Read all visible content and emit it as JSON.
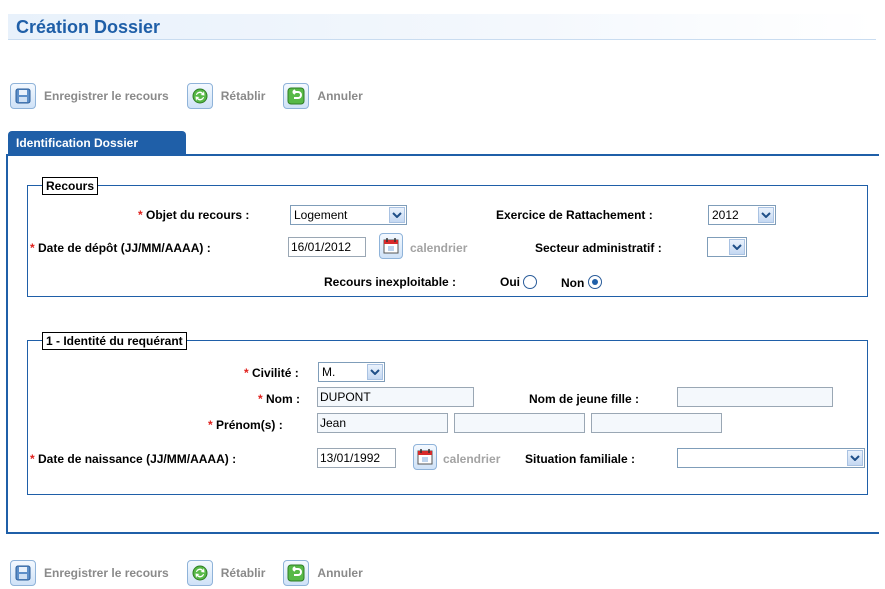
{
  "page": {
    "title": "Création Dossier"
  },
  "toolbar": {
    "save_label": "Enregistrer le recours",
    "reset_label": "Rétablir",
    "cancel_label": "Annuler"
  },
  "tabs": [
    {
      "label": "Identification Dossier",
      "active": true
    }
  ],
  "recours": {
    "legend": "Recours",
    "objet_label": "Objet du recours :",
    "objet_value": "Logement",
    "exercice_label": "Exercice de Rattachement :",
    "exercice_value": "2012",
    "date_depot_label": "Date de dépôt (JJ/MM/AAAA) :",
    "date_depot_value": "16/01/2012",
    "calendar_label": "calendrier",
    "secteur_label": "Secteur administratif :",
    "secteur_value": "",
    "inexploitable_label": "Recours inexploitable :",
    "oui_label": "Oui",
    "non_label": "Non",
    "inexploitable_selected": "Non"
  },
  "identite": {
    "legend": "1 - Identité du requérant",
    "civilite_label": "Civilité :",
    "civilite_value": "M.",
    "nom_label": "Nom :",
    "nom_value": "DUPONT",
    "nom_jeune_fille_label": "Nom de jeune fille :",
    "nom_jeune_fille_value": "",
    "prenom_label": "Prénom(s) :",
    "prenom_values": [
      "Jean",
      "",
      ""
    ],
    "date_naissance_label": "Date de naissance (JJ/MM/AAAA) :",
    "date_naissance_value": "13/01/1992",
    "calendar_label": "calendrier",
    "situation_label": "Situation familiale :",
    "situation_value": ""
  },
  "required_marker": "*",
  "colors": {
    "accent": "#1f5fa8",
    "required": "#e0201c",
    "disabled_text": "#8a8a8a"
  },
  "icons": {
    "save": "save-icon",
    "reset": "refresh-icon",
    "cancel": "undo-icon",
    "calendar": "calendar-icon",
    "dropdown": "chevron-down-icon"
  }
}
